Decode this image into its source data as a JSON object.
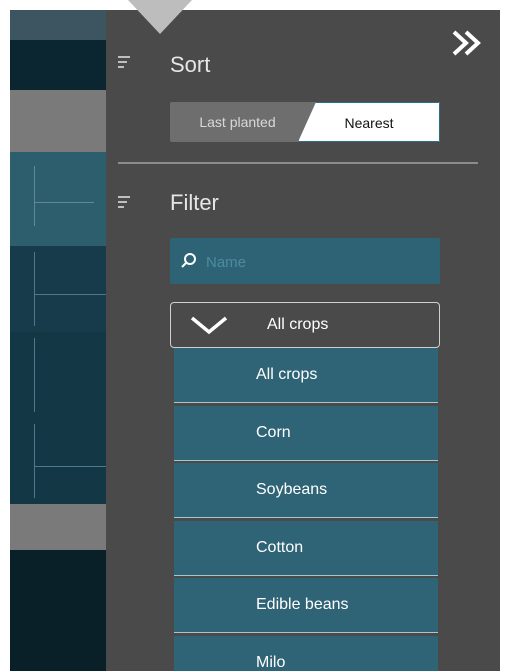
{
  "sort": {
    "title": "Sort",
    "options": [
      "Last planted",
      "Nearest"
    ],
    "selected": "Nearest"
  },
  "filter": {
    "title": "Filter",
    "search_placeholder": "Name",
    "crop_select": {
      "selected": "All crops",
      "options": [
        "All crops",
        "Corn",
        "Soybeans",
        "Cotton",
        "Edible beans",
        "Milo"
      ]
    }
  },
  "icons": {
    "collapse": "double-chevron-right-icon",
    "sort": "sort-lines-icon",
    "filter": "filter-lines-icon",
    "search": "search-icon",
    "dropdown": "chevron-down-icon"
  },
  "colors": {
    "panel_bg": "#4a4a4a",
    "accent": "#2f6376",
    "map_dark": "#0f2a36"
  }
}
